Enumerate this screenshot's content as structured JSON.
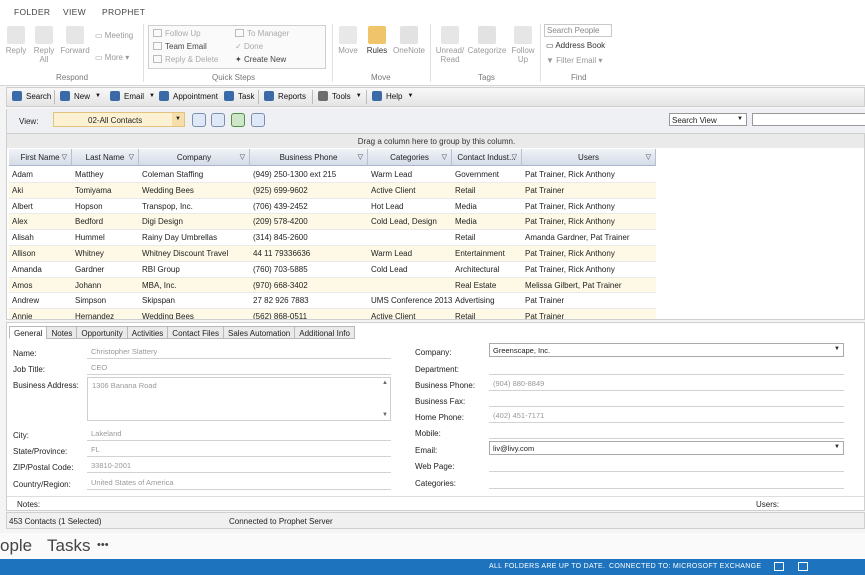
{
  "menu": {
    "folder": "FOLDER",
    "view": "VIEW",
    "prophet": "PROPHET"
  },
  "ribbon": {
    "respond": {
      "label": "Respond",
      "reply": "Reply",
      "reply_all": "Reply All",
      "forward": "Forward",
      "meeting": "Meeting",
      "more": "More"
    },
    "quick_steps": {
      "label": "Quick Steps",
      "follow_up": "Follow Up",
      "team_email": "Team Email",
      "reply_delete": "Reply & Delete",
      "to_manager": "To Manager",
      "done": "Done",
      "create_new": "Create New"
    },
    "move": {
      "label": "Move",
      "move": "Move",
      "rules": "Rules",
      "onenote": "OneNote"
    },
    "tags": {
      "label": "Tags",
      "unread_read": "Unread/ Read",
      "categorize": "Categorize",
      "follow_up": "Follow Up"
    },
    "find": {
      "label": "Find",
      "search_people_placeholder": "Search People",
      "address_book": "Address Book",
      "filter_email": "Filter Email"
    }
  },
  "toolbar": {
    "search": "Search",
    "new": "New",
    "email": "Email",
    "appointment": "Appointment",
    "task": "Task",
    "reports": "Reports",
    "tools": "Tools",
    "help": "Help"
  },
  "view": {
    "label": "View:",
    "selected": "02-All Contacts",
    "search_view": "Search View"
  },
  "grid": {
    "drag_hint": "Drag a column here to group by this column.",
    "columns": [
      "First Name",
      "Last Name",
      "Company",
      "Business Phone",
      "Categories",
      "Contact Indust...",
      "Users"
    ],
    "rows": [
      [
        "Adam",
        "Matthey",
        "Coleman Staffing",
        "(949) 250-1300 ext 215",
        "Warm Lead",
        "Government",
        "Pat Trainer, Rick Anthony"
      ],
      [
        "Aki",
        "Tomiyama",
        "Wedding Bees",
        "(925) 699-9602",
        "Active Client",
        "Retail",
        "Pat Trainer"
      ],
      [
        "Albert",
        "Hopson",
        "Transpop, Inc.",
        "(706) 439-2452",
        "Hot Lead",
        "Media",
        "Pat Trainer, Rick Anthony"
      ],
      [
        "Alex",
        "Bedford",
        "Digi Design",
        "(209) 578-4200",
        "Cold Lead, Design",
        "Media",
        "Pat Trainer, Rick Anthony"
      ],
      [
        "Alisah",
        "Hummel",
        "Rainy Day Umbrellas",
        "(314) 845-2600",
        "",
        "Retail",
        "Amanda Gardner, Pat Trainer"
      ],
      [
        "Allison",
        "Whitney",
        "Whitney Discount Travel",
        "44 11 79336636",
        "Warm Lead",
        "Entertainment",
        "Pat Trainer, Rick Anthony"
      ],
      [
        "Amanda",
        "Gardner",
        "RBI Group",
        "(760) 703-5885",
        "Cold Lead",
        "Architectural",
        "Pat Trainer, Rick Anthony"
      ],
      [
        "Amos",
        "Johann",
        "MBA, Inc.",
        "(970) 668-3402",
        "",
        "Real Estate",
        "Melissa Gilbert, Pat Trainer"
      ],
      [
        "Andrew",
        "Simpson",
        "Skipspan",
        "27 82 926 7883",
        "UMS Conference 2013",
        "Advertising",
        "Pat Trainer"
      ],
      [
        "Annie",
        "Hernandez",
        "Wedding Bees",
        "(562) 868-0511",
        "Active Client",
        "Retail",
        "Pat Trainer"
      ]
    ]
  },
  "tabs": [
    "General",
    "Notes",
    "Opportunity",
    "Activities",
    "Contact Files",
    "Sales Automation",
    "Additional Info"
  ],
  "detail": {
    "name_label": "Name:",
    "name": "Christopher Slattery",
    "job_title_label": "Job Title:",
    "job_title": "CEO",
    "address_label": "Business Address:",
    "address": "1306 Banana Road",
    "city_label": "City:",
    "city": "Lakeland",
    "state_label": "State/Province:",
    "state": "FL",
    "zip_label": "ZIP/Postal Code:",
    "zip": "33810-2001",
    "country_label": "Country/Region:",
    "country": "United States of America",
    "company_label": "Company:",
    "company": "Greenscape, Inc.",
    "department_label": "Department:",
    "bphone_label": "Business Phone:",
    "bphone": "(904) 880-8849",
    "bfax_label": "Business Fax:",
    "hphone_label": "Home Phone:",
    "hphone": "(402) 451-7171",
    "mobile_label": "Mobile:",
    "email_label": "Email:",
    "email": "liv@livy.com",
    "webpage_label": "Web Page:",
    "categories_label": "Categories:",
    "notes_label": "Notes:",
    "users_label": "Users:"
  },
  "status": {
    "count": "453 Contacts (1 Selected)",
    "connection": "Connected to Prophet Server"
  },
  "bottom_nav": {
    "people": "ople",
    "tasks": "Tasks",
    "more": "•••"
  },
  "appbar": {
    "folders": "ALL FOLDERS ARE UP TO DATE.",
    "exchange": "CONNECTED TO: MICROSOFT EXCHANGE"
  }
}
